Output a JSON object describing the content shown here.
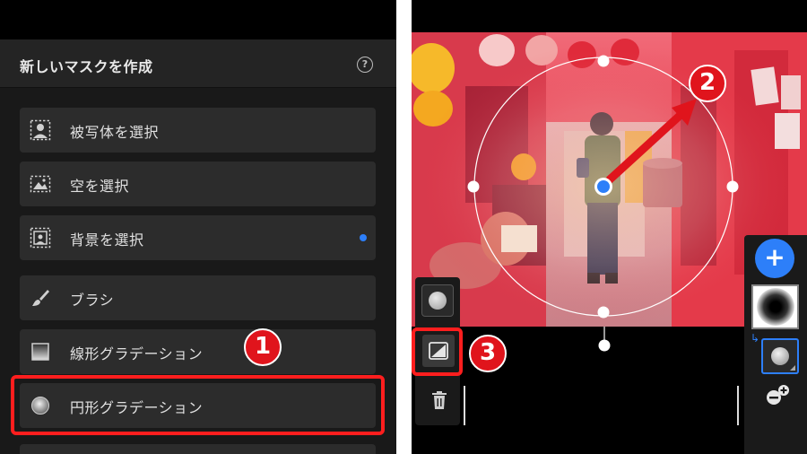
{
  "mask_panel": {
    "title": "新しいマスクを作成",
    "help_icon": "?",
    "items": [
      {
        "label": "被写体を選択",
        "icon": "select-subject-icon"
      },
      {
        "label": "空を選択",
        "icon": "select-sky-icon"
      },
      {
        "label": "背景を選択",
        "icon": "select-background-icon",
        "has_dot": true
      },
      {
        "label": "ブラシ",
        "icon": "brush-icon"
      },
      {
        "label": "線形グラデーション",
        "icon": "linear-gradient-icon"
      },
      {
        "label": "円形グラデーション",
        "icon": "radial-gradient-icon",
        "highlighted": true
      }
    ]
  },
  "steps": {
    "one": "1",
    "two": "2",
    "three": "3"
  },
  "right_toolbar": {
    "add_label": "+"
  },
  "colors": {
    "accent": "#2d7ff9",
    "highlight": "#ff1e1e",
    "badge": "#e0141c"
  }
}
